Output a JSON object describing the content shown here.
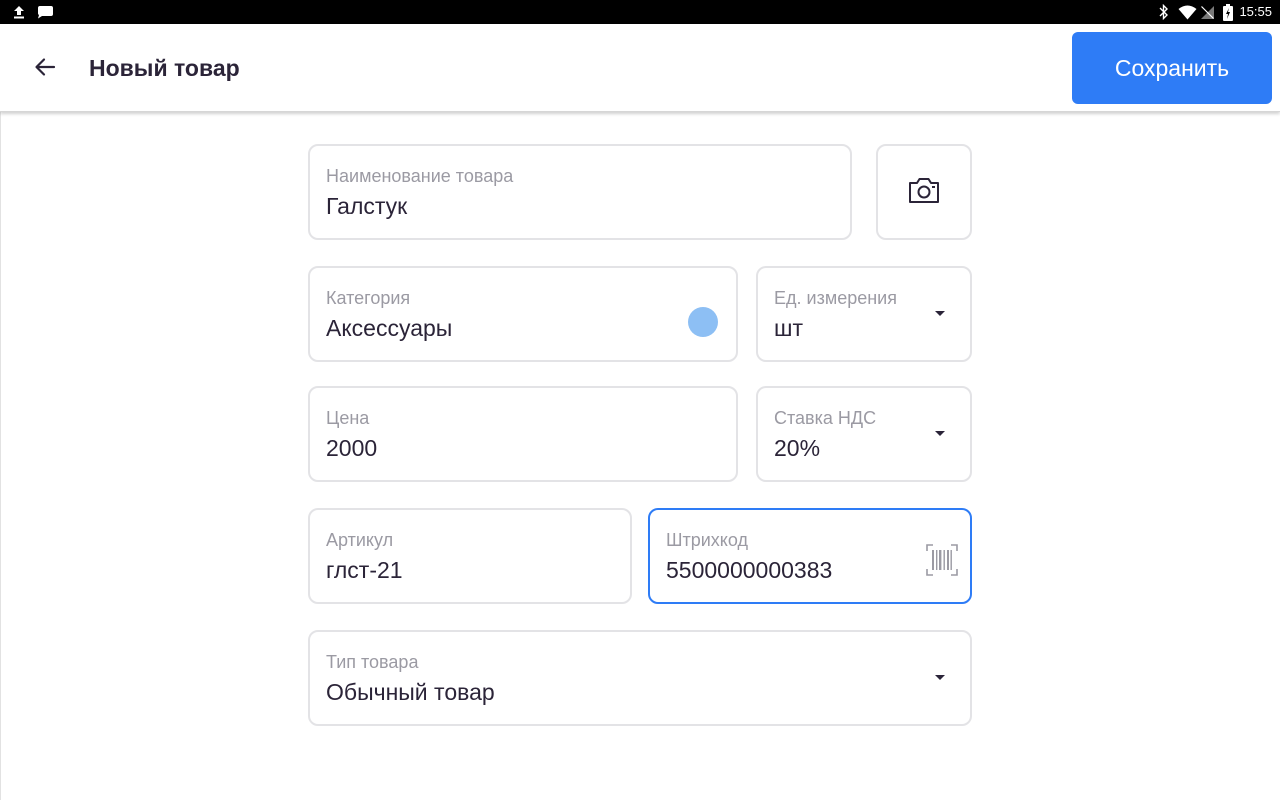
{
  "status_bar": {
    "time": "15:55",
    "icons": [
      "upload-icon",
      "message-icon",
      "bluetooth-icon",
      "wifi-icon",
      "signal-icon",
      "battery-charging-icon"
    ]
  },
  "header": {
    "title": "Новый товар",
    "save_label": "Сохранить",
    "back_icon": "arrow-left-icon"
  },
  "colors": {
    "accent": "#2e7cf6",
    "text": "#2b2438",
    "label": "#9b9aa3",
    "border": "#e3e3e6"
  },
  "form": {
    "name": {
      "label": "Наименование товара",
      "value": "Галстук"
    },
    "photo": {
      "icon": "camera-icon"
    },
    "category": {
      "label": "Категория",
      "value": "Аксессуары"
    },
    "unit": {
      "label": "Ед. измерения",
      "value": "шт"
    },
    "price": {
      "label": "Цена",
      "value": "2000"
    },
    "vat": {
      "label": "Ставка НДС",
      "value": "20%"
    },
    "sku": {
      "label": "Артикул",
      "value": "глст-21"
    },
    "barcode": {
      "label": "Штрихкод",
      "value": "5500000000383",
      "icon": "barcode-scan-icon"
    },
    "type": {
      "label": "Тип товара",
      "value": "Обычный товар"
    }
  }
}
